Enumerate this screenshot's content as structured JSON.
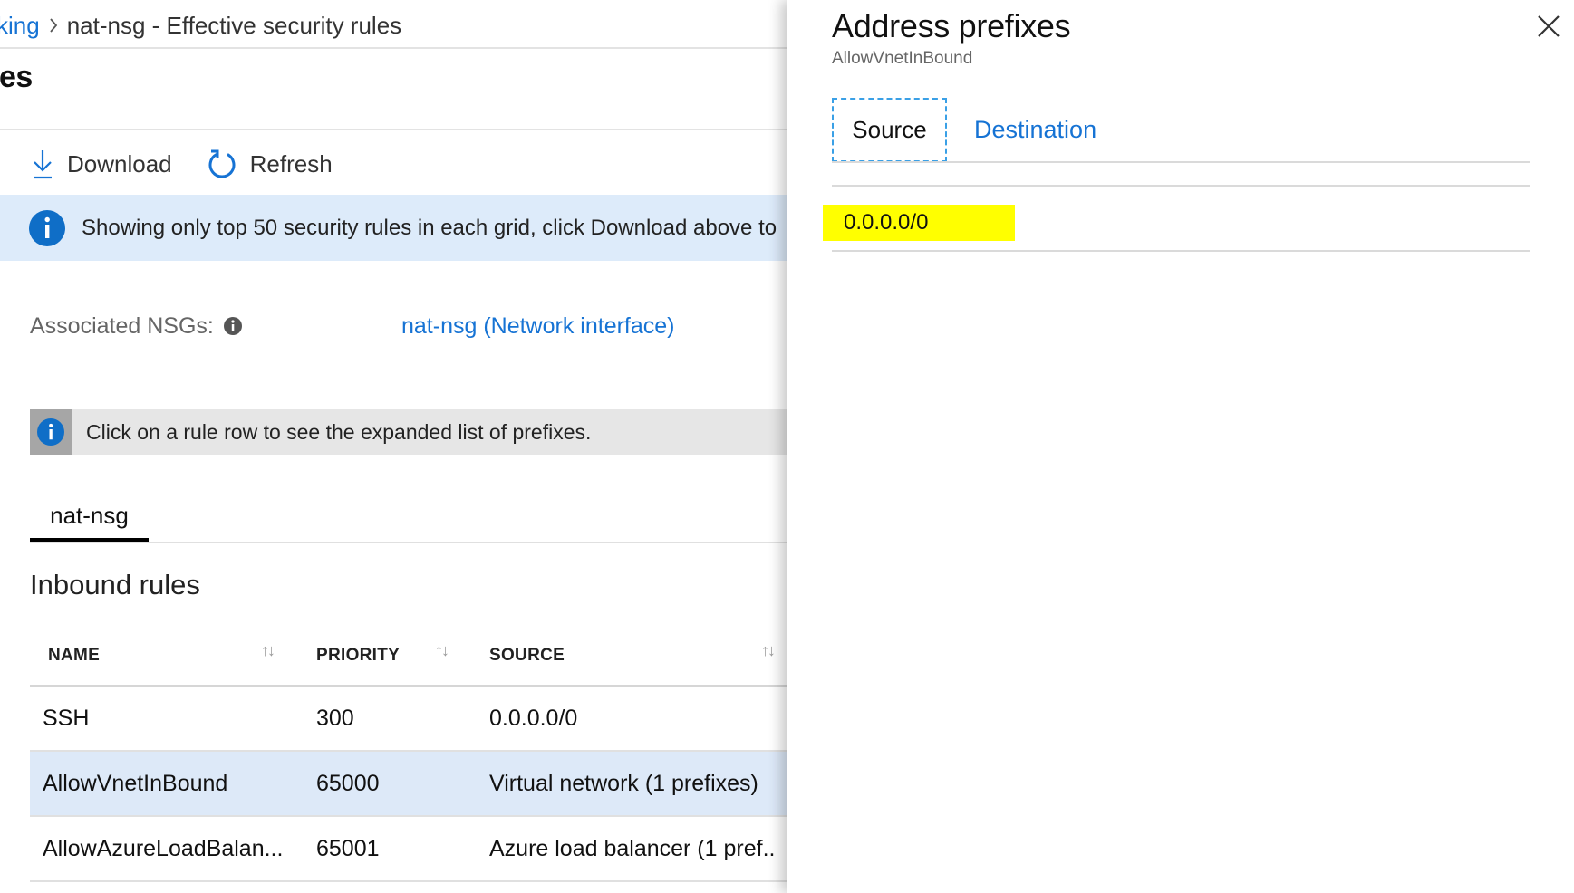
{
  "breadcrumb": {
    "parent": "king",
    "current": "nat-nsg - Effective security rules"
  },
  "page": {
    "title": "les"
  },
  "toolbar": {
    "download": "Download",
    "refresh": "Refresh"
  },
  "banner": {
    "text": "Showing only top 50 security rules in each grid, click Download above to"
  },
  "associated": {
    "label": "Associated NSGs:",
    "link": "nat-nsg (Network interface)"
  },
  "note": {
    "text": "Click on a rule row to see the expanded list of prefixes."
  },
  "tab": {
    "label": "nat-nsg"
  },
  "inbound": {
    "title": "Inbound rules",
    "columns": {
      "name": "NAME",
      "priority": "PRIORITY",
      "source": "SOURCE"
    },
    "sort_glyph": "↑↓",
    "rows": [
      {
        "name": "SSH",
        "priority": "300",
        "source": "0.0.0.0/0"
      },
      {
        "name": "AllowVnetInBound",
        "priority": "65000",
        "source": "Virtual network (1 prefixes)"
      },
      {
        "name": "AllowAzureLoadBalan...",
        "priority": "65001",
        "source": "Azure load balancer (1 pref.."
      }
    ]
  },
  "panel": {
    "title": "Address prefixes",
    "subtitle": "AllowVnetInBound",
    "tabs": {
      "source": "Source",
      "destination": "Destination"
    },
    "prefix": "0.0.0.0/0",
    "highlight_color": "#ffff00"
  },
  "colors": {
    "link": "#1673d4",
    "banner_bg": "#ddebfa",
    "selected_row": "#dde9f8",
    "info_blue": "#0f6ec7"
  },
  "icons": [
    "chevron-right-icon",
    "download-icon",
    "refresh-icon",
    "info-icon",
    "close-icon"
  ]
}
